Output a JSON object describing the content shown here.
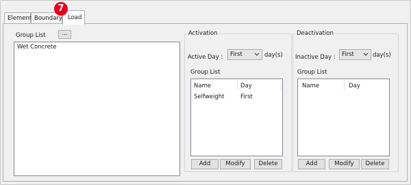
{
  "annotation": {
    "step_number": "7"
  },
  "tabs": [
    {
      "label": "Element"
    },
    {
      "label": "Boundary"
    },
    {
      "label": "Load"
    }
  ],
  "group_list": {
    "label": "Group List",
    "browse_button": "...",
    "items": [
      "Wet Concrete"
    ]
  },
  "activation": {
    "title": "Activation",
    "active_day_label": "Active Day :",
    "active_day_value": "First",
    "unit": "day(s)",
    "group_list_label": "Group List",
    "columns": [
      "Name",
      "Day"
    ],
    "rows": [
      {
        "name": "Selfweight",
        "day": "First"
      }
    ],
    "buttons": {
      "add": "Add",
      "modify": "Modify",
      "delete": "Delete"
    }
  },
  "deactivation": {
    "title": "Deactivation",
    "inactive_day_label": "Inactive Day :",
    "inactive_day_value": "First",
    "unit": "day(s)",
    "group_list_label": "Group List",
    "columns": [
      "Name",
      "Day"
    ],
    "rows": [],
    "buttons": {
      "add": "Add",
      "modify": "Modify",
      "delete": "Delete"
    }
  }
}
